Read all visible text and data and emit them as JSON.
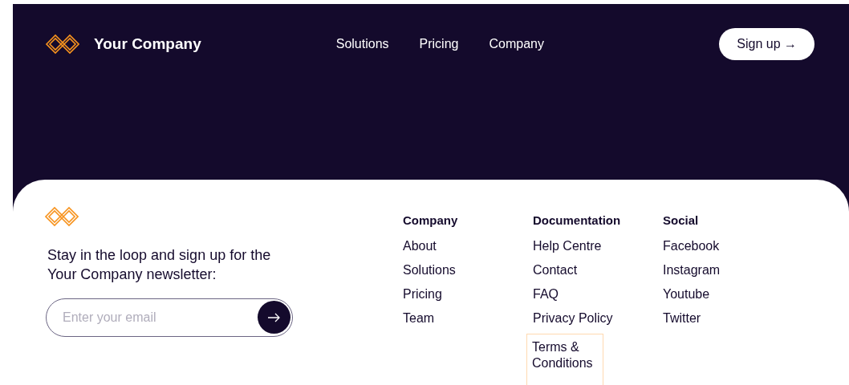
{
  "header": {
    "brand": "Your Company",
    "nav": [
      {
        "label": "Solutions"
      },
      {
        "label": "Pricing"
      },
      {
        "label": "Company"
      }
    ],
    "signup_button": "Sign up →"
  },
  "footer": {
    "newsletter_text": "Stay in the loop and sign up for the Your Company newsletter:",
    "email_field": {
      "placeholder": "Enter your email"
    },
    "columns": [
      {
        "heading": "Company",
        "links": [
          {
            "label": "About",
            "focused": false
          },
          {
            "label": "Solutions",
            "focused": false
          },
          {
            "label": "Pricing",
            "focused": false
          },
          {
            "label": "Team",
            "focused": false
          }
        ]
      },
      {
        "heading": "Documentation",
        "links": [
          {
            "label": "Help Centre",
            "focused": false
          },
          {
            "label": "Contact",
            "focused": false
          },
          {
            "label": "FAQ",
            "focused": false
          },
          {
            "label": "Privacy Policy",
            "focused": false
          },
          {
            "label": "Terms & Conditions",
            "focused": true
          }
        ]
      },
      {
        "heading": "Social",
        "links": [
          {
            "label": "Facebook",
            "focused": false
          },
          {
            "label": "Instagram",
            "focused": false
          },
          {
            "label": "Youtube",
            "focused": false
          },
          {
            "label": "Twitter",
            "focused": false
          }
        ]
      }
    ]
  }
}
